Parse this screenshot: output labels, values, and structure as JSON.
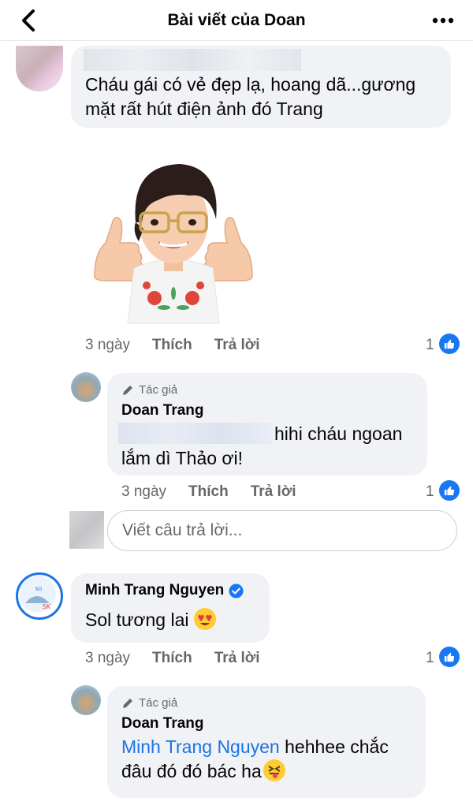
{
  "header": {
    "title": "Bài viết của Doan"
  },
  "comments": [
    {
      "text": "Cháu gái có vẻ đẹp lạ, hoang dã...gương mặt rất hút điện ảnh đó Trang",
      "time": "3 ngày",
      "like_label": "Thích",
      "reply_label": "Trả lời",
      "reactions": "1"
    },
    {
      "author_tag": "Tác giả",
      "author": "Doan Trang",
      "text": "hihi cháu ngoan lắm dì Thảo ơi!",
      "time": "3 ngày",
      "like_label": "Thích",
      "reply_label": "Trả lời",
      "reactions": "1"
    },
    {
      "author": "Minh Trang Nguyen",
      "text": "Sol tương lai",
      "time": "3 ngày",
      "like_label": "Thích",
      "reply_label": "Trả lời",
      "reactions": "1"
    },
    {
      "author_tag": "Tác giả",
      "author": "Doan Trang",
      "mention": "Minh Trang Nguyen",
      "text_after_mention": " hehhee chắc đâu đó đó bác ha"
    }
  ],
  "reply_input": {
    "placeholder": "Viết câu trả lời..."
  },
  "colors": {
    "link": "#1b74e4",
    "like_badge": "#1877f2",
    "bubble": "#f0f2f5",
    "meta": "#65676b"
  },
  "icons": [
    "back-icon",
    "more-icon",
    "like-icon",
    "pencil-icon",
    "verified-icon",
    "heart-eyes-emoji",
    "tongue-emoji"
  ]
}
